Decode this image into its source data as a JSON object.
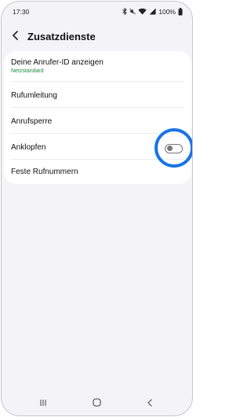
{
  "status_bar": {
    "time": "17:30",
    "battery": "100%",
    "icons": [
      "bluetooth-icon",
      "mute-icon",
      "wifi-icon",
      "signal-icon",
      "battery-icon"
    ]
  },
  "header": {
    "title": "Zusatzdienste",
    "back_icon": "chevron-left-icon"
  },
  "settings": {
    "caller_id": {
      "label": "Deine Anrufer-ID anzeigen",
      "value": "Netzstandard"
    },
    "call_forwarding": {
      "label": "Rufumleitung"
    },
    "call_barring": {
      "label": "Anrufsperre"
    },
    "call_waiting": {
      "label": "Anklopfen",
      "enabled": false
    },
    "fixed_dialing": {
      "label": "Feste Rufnummern"
    }
  },
  "nav_bar": {
    "icons": [
      "recent-apps-icon",
      "home-icon",
      "back-icon"
    ]
  },
  "colors": {
    "accent_highlight": "#1a73e8",
    "subtext_green": "#1f8a3c",
    "background": "#f4f4f6"
  }
}
